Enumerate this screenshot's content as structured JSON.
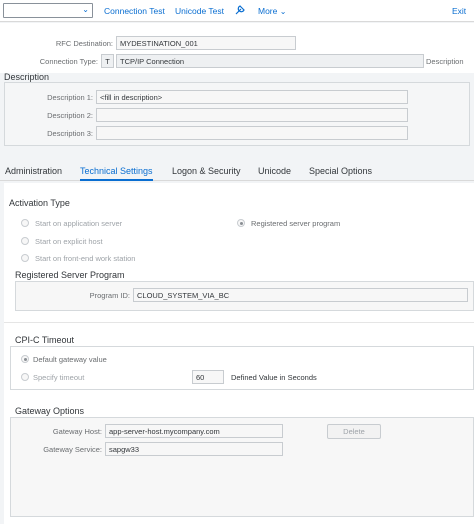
{
  "toolbar": {
    "select_value": "",
    "connection_test": "Connection Test",
    "unicode_test": "Unicode Test",
    "more": "More",
    "exit": "Exit"
  },
  "header": {
    "rfc_destination_label": "RFC Destination:",
    "rfc_destination_value": "MYDESTINATION_001",
    "connection_type_label": "Connection Type:",
    "connection_type_code": "T",
    "connection_type_value": "TCP/IP Connection",
    "description_right_label": "Description"
  },
  "description": {
    "title": "Description",
    "labels": [
      "Description 1:",
      "Description 2:",
      "Description 3:"
    ],
    "values": [
      "<fill in description>",
      "",
      ""
    ]
  },
  "tabs": [
    {
      "label": "Administration",
      "active": false
    },
    {
      "label": "Technical Settings",
      "active": true
    },
    {
      "label": "Logon & Security",
      "active": false
    },
    {
      "label": "Unicode",
      "active": false
    },
    {
      "label": "Special Options",
      "active": false
    }
  ],
  "activation": {
    "title": "Activation Type",
    "options": [
      {
        "label": "Start on application server",
        "selected": false
      },
      {
        "label": "Registered server program",
        "selected": true
      },
      {
        "label": "Start on explicit host",
        "selected": false
      },
      {
        "label": "Start on front-end work station",
        "selected": false
      }
    ]
  },
  "registered": {
    "title": "Registered Server Program",
    "program_id_label": "Program ID:",
    "program_id_value": "CLOUD_SYSTEM_VIA_BC"
  },
  "cpic": {
    "title": "CPI-C Timeout",
    "default_label": "Default gateway value",
    "specify_label": "Specify timeout",
    "timeout_value": "60",
    "timeout_unit": "Defined Value in Seconds"
  },
  "gateway": {
    "title": "Gateway Options",
    "host_label": "Gateway Host:",
    "host_value": "app-server-host.mycompany.com",
    "service_label": "Gateway Service:",
    "service_value": "sapgw33",
    "delete_label": "Delete"
  },
  "colors": {
    "accent": "#0a6ed1",
    "text": "#32363a",
    "label": "#6a6d70"
  }
}
